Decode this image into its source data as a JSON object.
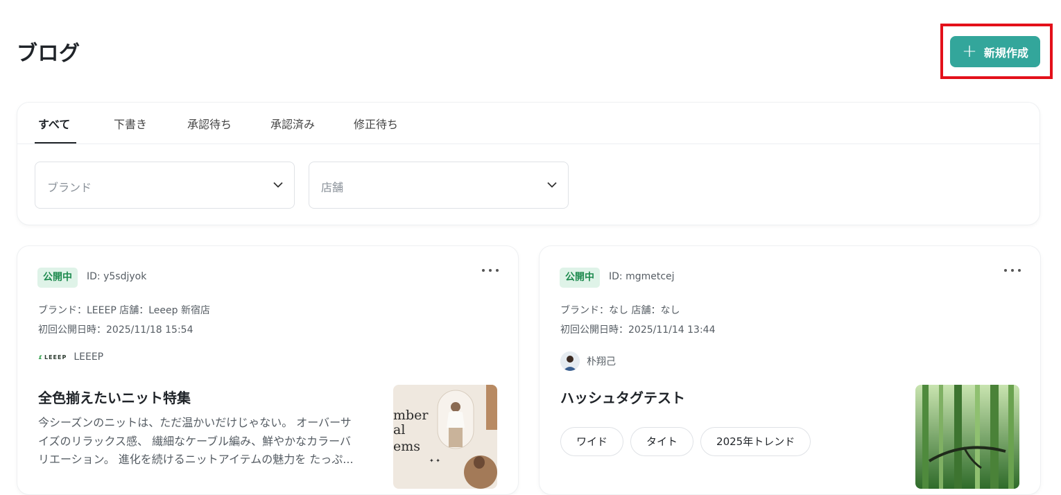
{
  "header": {
    "title": "ブログ",
    "new_button_label": "新規作成"
  },
  "tabs": [
    {
      "label": "すべて",
      "active": true
    },
    {
      "label": "下書き",
      "active": false
    },
    {
      "label": "承認待ち",
      "active": false
    },
    {
      "label": "承認済み",
      "active": false
    },
    {
      "label": "修正待ち",
      "active": false
    }
  ],
  "filters": {
    "brand_placeholder": "ブランド",
    "store_placeholder": "店舗"
  },
  "posts": [
    {
      "status": "公開中",
      "id": "ID: y5sdjyok",
      "brand_store": "ブランド：LEEEP  店舗：Leeep 新宿店",
      "published": "初回公開日時：2025/11/18 15:54",
      "author_logo": "LEEEP",
      "author": "LEEEP",
      "title": "全色揃えたいニット特集",
      "excerpt_lines": [
        "今シーズンのニットは、ただ温かいだけじゃない。 オーバーサ",
        "イズのリラックス感、 繊細なケーブル編み、鮮やかなカラーバ",
        "リエーション。 進化を続けるニットアイテムの魅力を たっぷ..."
      ],
      "thumbnail_text": [
        "mber",
        "al",
        "ems"
      ]
    },
    {
      "status": "公開中",
      "id": "ID: mgmetcej",
      "brand_store": "ブランド：なし  店舗：なし",
      "published": "初回公開日時：2025/11/14 13:44",
      "author": "朴翔己",
      "title": "ハッシュタグテスト",
      "tags": [
        "ワイド",
        "タイト",
        "2025年トレンド"
      ]
    }
  ],
  "colors": {
    "accent": "#33a69b",
    "highlight": "#e3101a",
    "status_bg": "#dff3e8",
    "status_text": "#1d8a4e"
  }
}
